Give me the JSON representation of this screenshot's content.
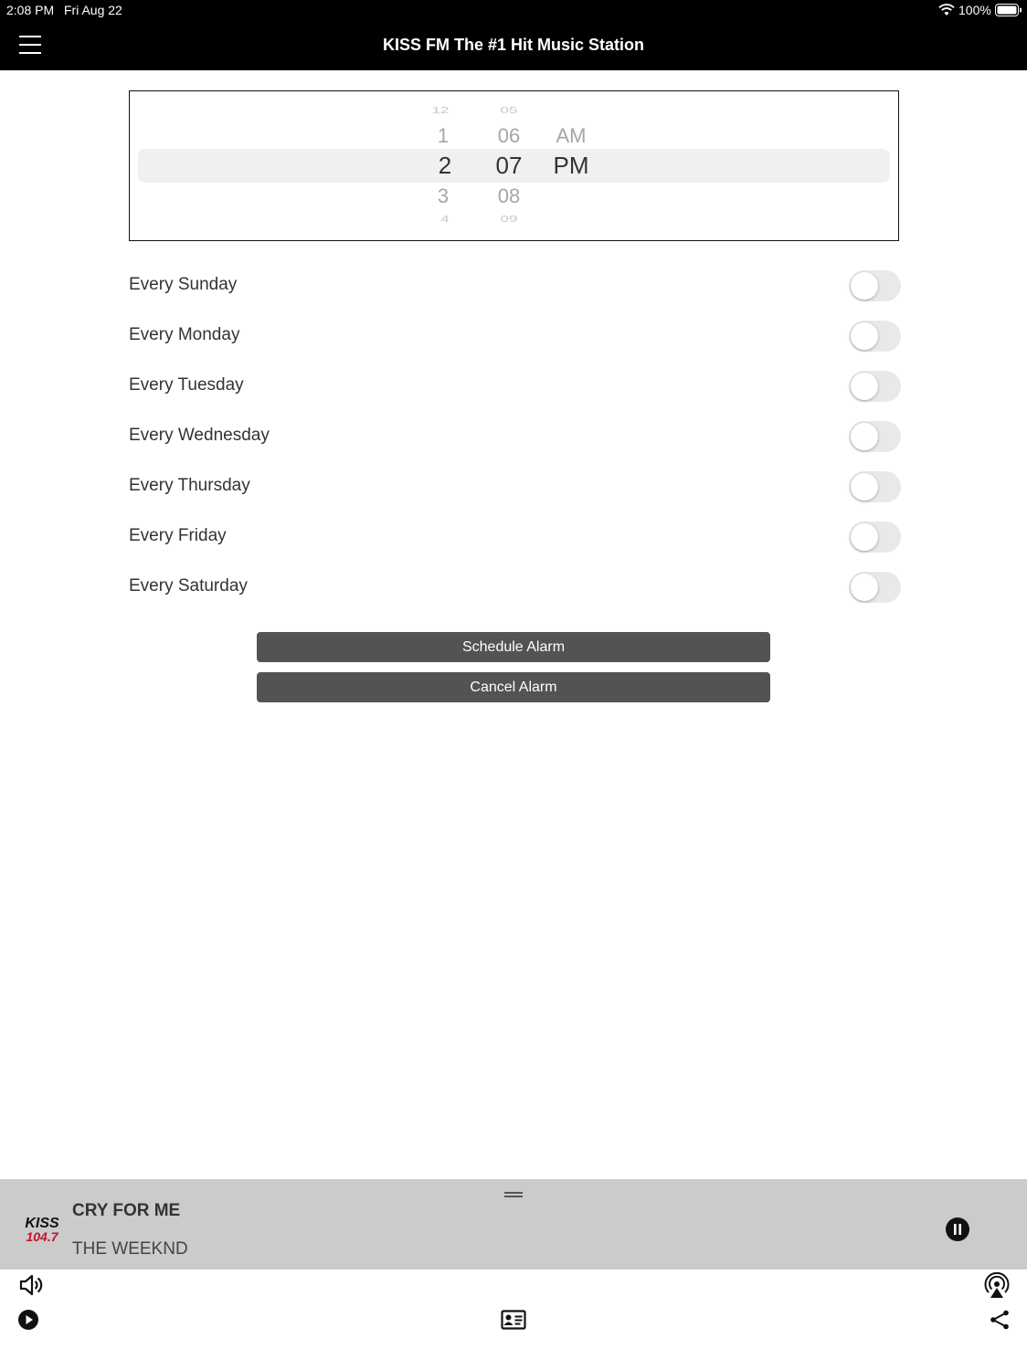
{
  "status_bar": {
    "time": "2:08 PM",
    "date": "Fri Aug 22",
    "battery": "100%"
  },
  "header": {
    "title": "KISS FM The #1 Hit Music Station"
  },
  "time_picker": {
    "hours": [
      "12",
      "1",
      "2",
      "3",
      "4"
    ],
    "minutes": [
      "05",
      "06",
      "07",
      "08",
      "09"
    ],
    "periods": [
      "AM",
      "PM"
    ],
    "selected": {
      "hour": "2",
      "minute": "07",
      "period": "PM"
    }
  },
  "days": [
    {
      "label": "Every Sunday",
      "on": false
    },
    {
      "label": "Every Monday",
      "on": false
    },
    {
      "label": "Every Tuesday",
      "on": false
    },
    {
      "label": "Every Wednesday",
      "on": false
    },
    {
      "label": "Every Thursday",
      "on": false
    },
    {
      "label": "Every Friday",
      "on": false
    },
    {
      "label": "Every Saturday",
      "on": false
    }
  ],
  "buttons": {
    "schedule": "Schedule Alarm",
    "cancel": "Cancel Alarm"
  },
  "now_playing": {
    "song": "CRY FOR ME",
    "artist": "THE WEEKND",
    "logo_text": "KISS 104.7"
  },
  "colors": {
    "bar_bg": "#000000",
    "button_bg": "#535353",
    "player_bg": "#cbcbcb",
    "logo_red": "#c8102e"
  },
  "icons": {
    "menu": "hamburger-icon",
    "pause": "pause-icon",
    "volume": "speaker-icon",
    "play": "play-icon",
    "contact": "contact-card-icon",
    "airplay": "airplay-icon",
    "share": "share-icon"
  }
}
